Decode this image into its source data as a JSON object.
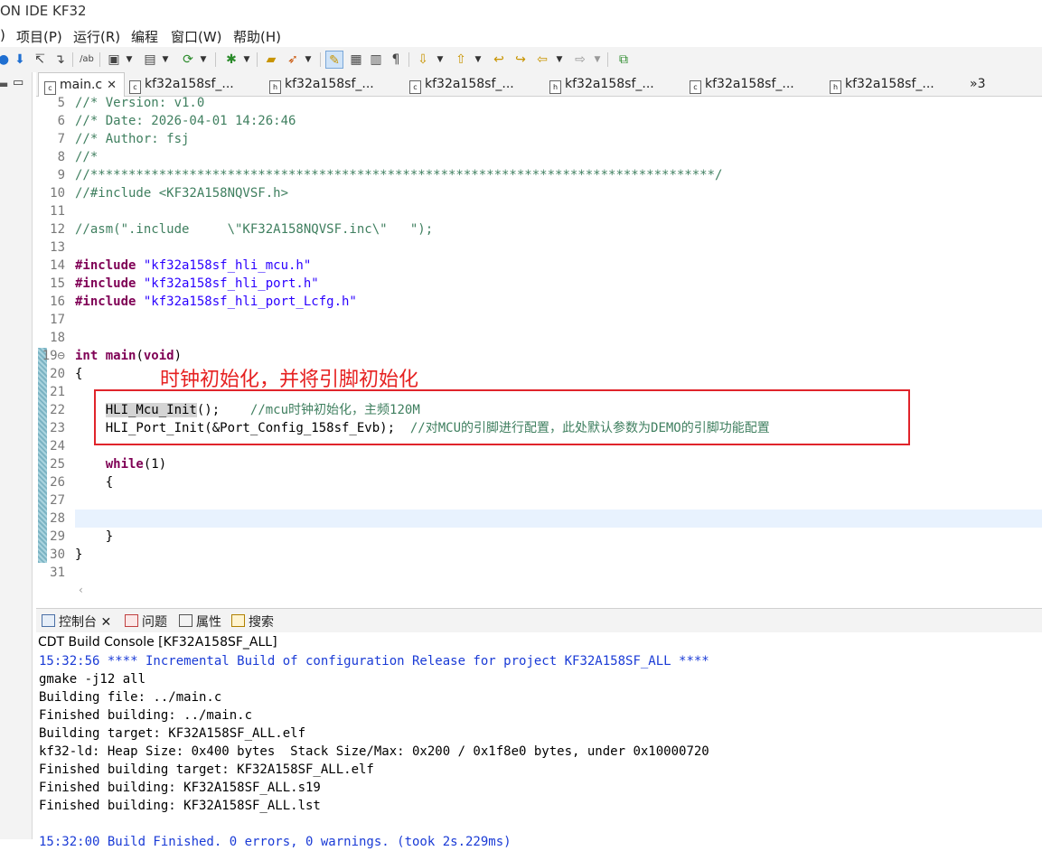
{
  "window": {
    "title": "ON IDE KF32"
  },
  "menu": [
    {
      "label": ")"
    },
    {
      "label": "项目(P)"
    },
    {
      "label": "运行(R)"
    },
    {
      "label": "编程"
    },
    {
      "label": "窗口(W)"
    },
    {
      "label": "帮助(H)"
    }
  ],
  "toolbar": {
    "icons": [
      "bullet-icon",
      "step-into-icon",
      "step-over-icon",
      "step-return-icon",
      "mnemonic-icon",
      "new-project-icon",
      "new-file-icon",
      "build-config-icon",
      "debug-icon",
      "open-icon",
      "run-icon",
      "highlight-icon",
      "outline-icon",
      "toggle-icon",
      "pilcrow-icon",
      "next-annotation-icon",
      "prev-annotation-icon",
      "last-edit-icon",
      "forward-edit-icon",
      "back-icon",
      "forward-icon",
      "external-icon"
    ]
  },
  "tabs": [
    {
      "label": "main.c",
      "active": true,
      "type": "c"
    },
    {
      "label": "kf32a158sf_...",
      "type": "c"
    },
    {
      "label": "kf32a158sf_...",
      "type": "h"
    },
    {
      "label": "kf32a158sf_...",
      "type": "c"
    },
    {
      "label": "kf32a158sf_...",
      "type": "h"
    },
    {
      "label": "kf32a158sf_...",
      "type": "c"
    },
    {
      "label": "kf32a158sf_...",
      "type": "h"
    },
    {
      "label": "»3"
    }
  ],
  "editor": {
    "lines": [
      {
        "n": "5",
        "parts": [
          [
            "cmt",
            "//* Version: v1.0"
          ]
        ]
      },
      {
        "n": "6",
        "parts": [
          [
            "cmt",
            "//* Date: 2026-04-01 14:26:46"
          ]
        ]
      },
      {
        "n": "7",
        "parts": [
          [
            "cmt",
            "//* Author: fsj"
          ]
        ]
      },
      {
        "n": "8",
        "parts": [
          [
            "cmt",
            "//*"
          ]
        ]
      },
      {
        "n": "9",
        "parts": [
          [
            "cmt",
            "//**********************************************************************************/"
          ]
        ]
      },
      {
        "n": "10",
        "parts": [
          [
            "cmt",
            "//#include <KF32A158NQVSF.h>"
          ]
        ]
      },
      {
        "n": "11",
        "parts": []
      },
      {
        "n": "12",
        "parts": [
          [
            "cmt",
            "//asm(\".include     \\\"KF32A158NQVSF.inc\\\"   \");"
          ]
        ]
      },
      {
        "n": "13",
        "parts": []
      },
      {
        "n": "14",
        "parts": [
          [
            "pp",
            "#include "
          ],
          [
            "str",
            "\"kf32a158sf_hli_mcu.h\""
          ]
        ]
      },
      {
        "n": "15",
        "parts": [
          [
            "pp",
            "#include "
          ],
          [
            "str",
            "\"kf32a158sf_hli_port.h\""
          ]
        ]
      },
      {
        "n": "16",
        "parts": [
          [
            "pp",
            "#include "
          ],
          [
            "str",
            "\"kf32a158sf_hli_port_Lcfg.h\""
          ]
        ]
      },
      {
        "n": "17",
        "parts": []
      },
      {
        "n": "18",
        "parts": []
      },
      {
        "n": "19⊖",
        "parts": [
          [
            "kw",
            "int "
          ],
          [
            "kw",
            "main"
          ],
          [
            "",
            "("
          ],
          [
            "kw",
            "void"
          ],
          [
            "",
            ")"
          ]
        ]
      },
      {
        "n": "20",
        "parts": [
          [
            "",
            "{"
          ]
        ]
      },
      {
        "n": "21",
        "parts": []
      },
      {
        "n": "22",
        "parts": [
          [
            "",
            "    "
          ],
          [
            "hl",
            "HLI_Mcu_Init"
          ],
          [
            "",
            "();    "
          ],
          [
            "cmt",
            "//mcu时钟初始化，主频120M"
          ]
        ]
      },
      {
        "n": "23",
        "parts": [
          [
            "",
            "    HLI_Port_Init(&Port_Config_158sf_Evb);  "
          ],
          [
            "cmt",
            "//对MCU的引脚进行配置，此处默认参数为DEMO的引脚功能配置"
          ]
        ]
      },
      {
        "n": "24",
        "parts": []
      },
      {
        "n": "25",
        "parts": [
          [
            "",
            "    "
          ],
          [
            "kw",
            "while"
          ],
          [
            "",
            "(1)"
          ]
        ]
      },
      {
        "n": "26",
        "parts": [
          [
            "",
            "    {"
          ]
        ]
      },
      {
        "n": "27",
        "parts": []
      },
      {
        "n": "28",
        "parts": []
      },
      {
        "n": "29",
        "parts": [
          [
            "",
            "    }"
          ]
        ]
      },
      {
        "n": "30",
        "parts": [
          [
            "",
            "}"
          ]
        ]
      },
      {
        "n": "31",
        "parts": []
      }
    ]
  },
  "annotation": {
    "text": "时钟初始化，并将引脚初始化"
  },
  "console": {
    "tabs": [
      {
        "label": "控制台",
        "icon": "console-icon"
      },
      {
        "label": "问题",
        "icon": "problems-icon"
      },
      {
        "label": "属性",
        "icon": "properties-icon"
      },
      {
        "label": "搜索",
        "icon": "search-icon"
      }
    ],
    "title": "CDT Build Console [KF32A158SF_ALL]",
    "lines": [
      {
        "text": "15:32:56 **** Incremental Build of configuration Release for project KF32A158SF_ALL ****",
        "color": "blue"
      },
      {
        "text": "gmake -j12 all"
      },
      {
        "text": "Building file: ../main.c"
      },
      {
        "text": "Finished building: ../main.c"
      },
      {
        "text": "Building target: KF32A158SF_ALL.elf"
      },
      {
        "text": "kf32-ld: Heap Size: 0x400 bytes  Stack Size/Max: 0x200 / 0x1f8e0 bytes, under 0x10000720"
      },
      {
        "text": "Finished building target: KF32A158SF_ALL.elf"
      },
      {
        "text": "Finished building: KF32A158SF_ALL.s19"
      },
      {
        "text": "Finished building: KF32A158SF_ALL.lst"
      },
      {
        "text": ""
      },
      {
        "text": "15:32:00 Build Finished. 0 errors, 0 warnings. (took 2s.229ms)",
        "color": "blue"
      }
    ]
  }
}
